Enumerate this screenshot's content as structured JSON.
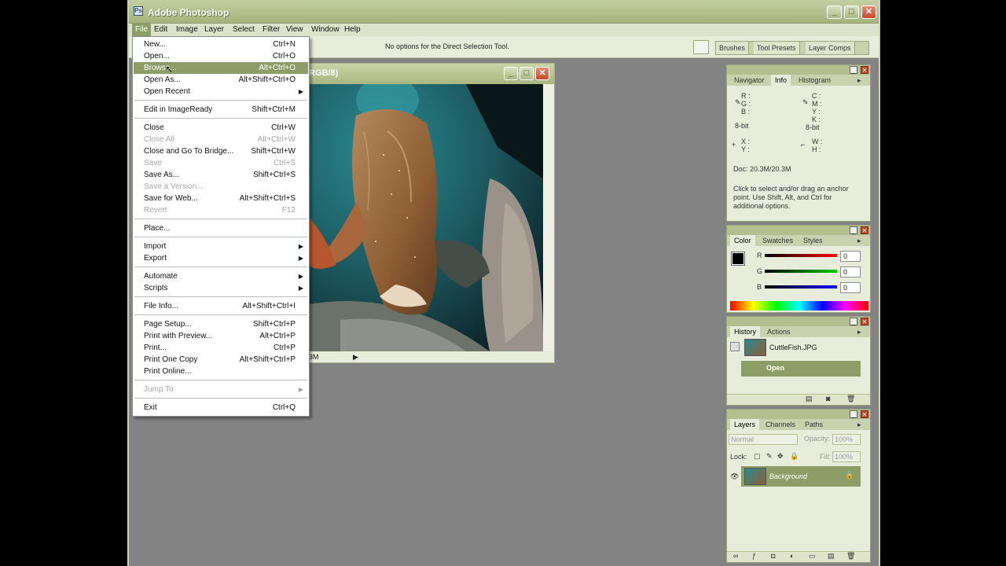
{
  "app": {
    "title": "Adobe Photoshop"
  },
  "menubar": [
    "File",
    "Edit",
    "Image",
    "Layer",
    "Select",
    "Filter",
    "View",
    "Window",
    "Help"
  ],
  "options_bar": {
    "message": "No options for the Direct Selection Tool.",
    "wells": [
      "Brushes",
      "Tool Presets",
      "Layer Comps"
    ]
  },
  "document": {
    "title_fragment": "RGB/8)",
    "status": "3M"
  },
  "file_menu": [
    {
      "label": "New...",
      "shortcut": "Ctrl+N"
    },
    {
      "label": "Open...",
      "shortcut": "Ctrl+O"
    },
    {
      "label": "Browse...",
      "shortcut": "Alt+Ctrl+O",
      "highlighted": true
    },
    {
      "label": "Open As...",
      "shortcut": "Alt+Shift+Ctrl+O"
    },
    {
      "label": "Open Recent",
      "submenu": true
    },
    {
      "sep": true
    },
    {
      "label": "Edit in ImageReady",
      "shortcut": "Shift+Ctrl+M"
    },
    {
      "sep": true
    },
    {
      "label": "Close",
      "shortcut": "Ctrl+W"
    },
    {
      "label": "Close All",
      "shortcut": "Alt+Ctrl+W",
      "disabled": true
    },
    {
      "label": "Close and Go To Bridge...",
      "shortcut": "Shift+Ctrl+W"
    },
    {
      "label": "Save",
      "shortcut": "Ctrl+S",
      "disabled": true
    },
    {
      "label": "Save As...",
      "shortcut": "Shift+Ctrl+S"
    },
    {
      "label": "Save a Version...",
      "disabled": true
    },
    {
      "label": "Save for Web...",
      "shortcut": "Alt+Shift+Ctrl+S"
    },
    {
      "label": "Revert",
      "shortcut": "F12",
      "disabled": true
    },
    {
      "sep": true
    },
    {
      "label": "Place..."
    },
    {
      "sep": true
    },
    {
      "label": "Import",
      "submenu": true
    },
    {
      "label": "Export",
      "submenu": true
    },
    {
      "sep": true
    },
    {
      "label": "Automate",
      "submenu": true
    },
    {
      "label": "Scripts",
      "submenu": true
    },
    {
      "sep": true
    },
    {
      "label": "File Info...",
      "shortcut": "Alt+Shift+Ctrl+I"
    },
    {
      "sep": true
    },
    {
      "label": "Page Setup...",
      "shortcut": "Shift+Ctrl+P"
    },
    {
      "label": "Print with Preview...",
      "shortcut": "Alt+Ctrl+P"
    },
    {
      "label": "Print...",
      "shortcut": "Ctrl+P"
    },
    {
      "label": "Print One Copy",
      "shortcut": "Alt+Shift+Ctrl+P"
    },
    {
      "label": "Print Online..."
    },
    {
      "sep": true
    },
    {
      "label": "Jump To",
      "submenu": true,
      "disabled": true
    },
    {
      "sep": true
    },
    {
      "label": "Exit",
      "shortcut": "Ctrl+Q"
    }
  ],
  "info_panel": {
    "tabs": [
      "Navigator",
      "Info",
      "Histogram"
    ],
    "active": "Info",
    "left_labels": [
      "R :",
      "G :",
      "B :"
    ],
    "right_labels": [
      "C :",
      "M :",
      "Y :",
      "K :"
    ],
    "bit_left": "8-bit",
    "bit_right": "8-bit",
    "xy": [
      "X :",
      "Y :"
    ],
    "wh": [
      "W :",
      "H :"
    ],
    "doc": "Doc: 20.3M/20.3M",
    "hint": "Click to select and/or drag an anchor point. Use Shift, Alt, and Ctrl for additional options."
  },
  "color_panel": {
    "tabs": [
      "Color",
      "Swatches",
      "Styles"
    ],
    "channels": [
      {
        "label": "R",
        "value": "0"
      },
      {
        "label": "G",
        "value": "0"
      },
      {
        "label": "B",
        "value": "0"
      }
    ]
  },
  "history_panel": {
    "tabs": [
      "History",
      "Actions"
    ],
    "snapshot": "CuttleFish.JPG",
    "state": "Open"
  },
  "layers_panel": {
    "tabs": [
      "Layers",
      "Channels",
      "Paths"
    ],
    "blend_mode": "Normal",
    "opacity_label": "Opacity:",
    "opacity": "100%",
    "lock_label": "Lock:",
    "fill_label": "Fill:",
    "fill": "100%",
    "layer": "Background"
  },
  "colors": {
    "accent": "#8c9d68"
  }
}
